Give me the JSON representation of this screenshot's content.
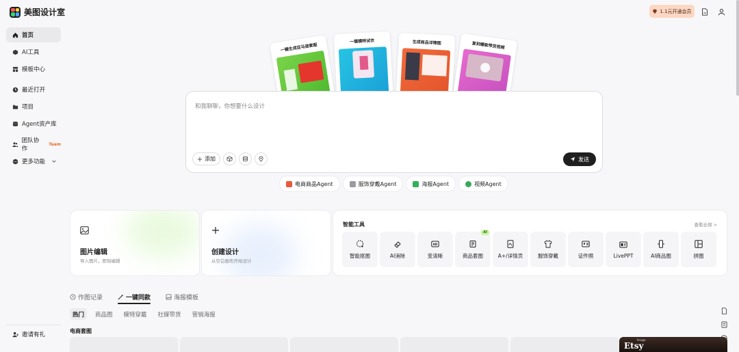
{
  "app": {
    "title": "美图设计室"
  },
  "sidebar": {
    "items": [
      {
        "label": "首页",
        "icon": "home-icon",
        "active": true
      },
      {
        "label": "AI工具",
        "icon": "cube-icon"
      },
      {
        "label": "模板中心",
        "icon": "grid-icon"
      },
      {
        "label": "最近打开",
        "icon": "clock-icon"
      },
      {
        "label": "项目",
        "icon": "folder-icon"
      },
      {
        "label": "Agent资产库",
        "icon": "database-icon"
      },
      {
        "label": "团队协作",
        "icon": "team-icon",
        "badge": "Team"
      },
      {
        "label": "更多功能",
        "icon": "more-icon"
      }
    ],
    "invite": "邀请有礼"
  },
  "header": {
    "vip_label": "1.1元开通会员"
  },
  "showcase": [
    {
      "title": "一键生成亚马逊套图"
    },
    {
      "title": "一键模特试衣"
    },
    {
      "title": "生成商品详情图"
    },
    {
      "title": "复刻爆款带货视频"
    }
  ],
  "chat": {
    "placeholder": "和我聊聊，你想要什么设计",
    "add_label": "添加",
    "send_label": "发送"
  },
  "agents": [
    {
      "label": "电商商品Agent",
      "color": "#e85a3c"
    },
    {
      "label": "服饰穿戴Agent",
      "color": "#9a9aa0"
    },
    {
      "label": "海报Agent",
      "color": "#35b05a"
    },
    {
      "label": "视频Agent",
      "color": "#3aa85c"
    }
  ],
  "features": {
    "image_edit": {
      "title": "图片编辑",
      "subtitle": "导入图片，即刻编辑"
    },
    "create": {
      "title": "创建设计",
      "subtitle": "从空白画布开始设计"
    }
  },
  "smart_tools": {
    "title": "智能工具",
    "more": "查看全部 >",
    "items": [
      {
        "label": "智能抠图",
        "icon": "cutout-icon"
      },
      {
        "label": "AI消除",
        "icon": "eraser-icon"
      },
      {
        "label": "变清晰",
        "icon": "hd-icon"
      },
      {
        "label": "商品套图",
        "icon": "product-set-icon",
        "badge": "AI"
      },
      {
        "label": "A+/详情页",
        "icon": "detail-page-icon"
      },
      {
        "label": "服饰穿戴",
        "icon": "apparel-icon"
      },
      {
        "label": "证件照",
        "icon": "id-photo-icon"
      },
      {
        "label": "LivePPT",
        "icon": "ppt-icon"
      },
      {
        "label": "AI商品图",
        "icon": "phone-product-icon"
      },
      {
        "label": "拼图",
        "icon": "collage-icon"
      }
    ]
  },
  "tabs": [
    {
      "label": "作图记录",
      "icon": "clock-icon"
    },
    {
      "label": "一键同款",
      "icon": "magic-wand-icon",
      "active": true
    },
    {
      "label": "海报模板",
      "icon": "image-icon"
    }
  ],
  "subtabs": [
    {
      "label": "热门",
      "active": true
    },
    {
      "label": "商品图"
    },
    {
      "label": "模特穿戴"
    },
    {
      "label": "社媒带货"
    },
    {
      "label": "营销海报"
    }
  ],
  "section": {
    "title": "电商套图"
  },
  "etsy": {
    "word": "Etsy",
    "small": "Image"
  }
}
